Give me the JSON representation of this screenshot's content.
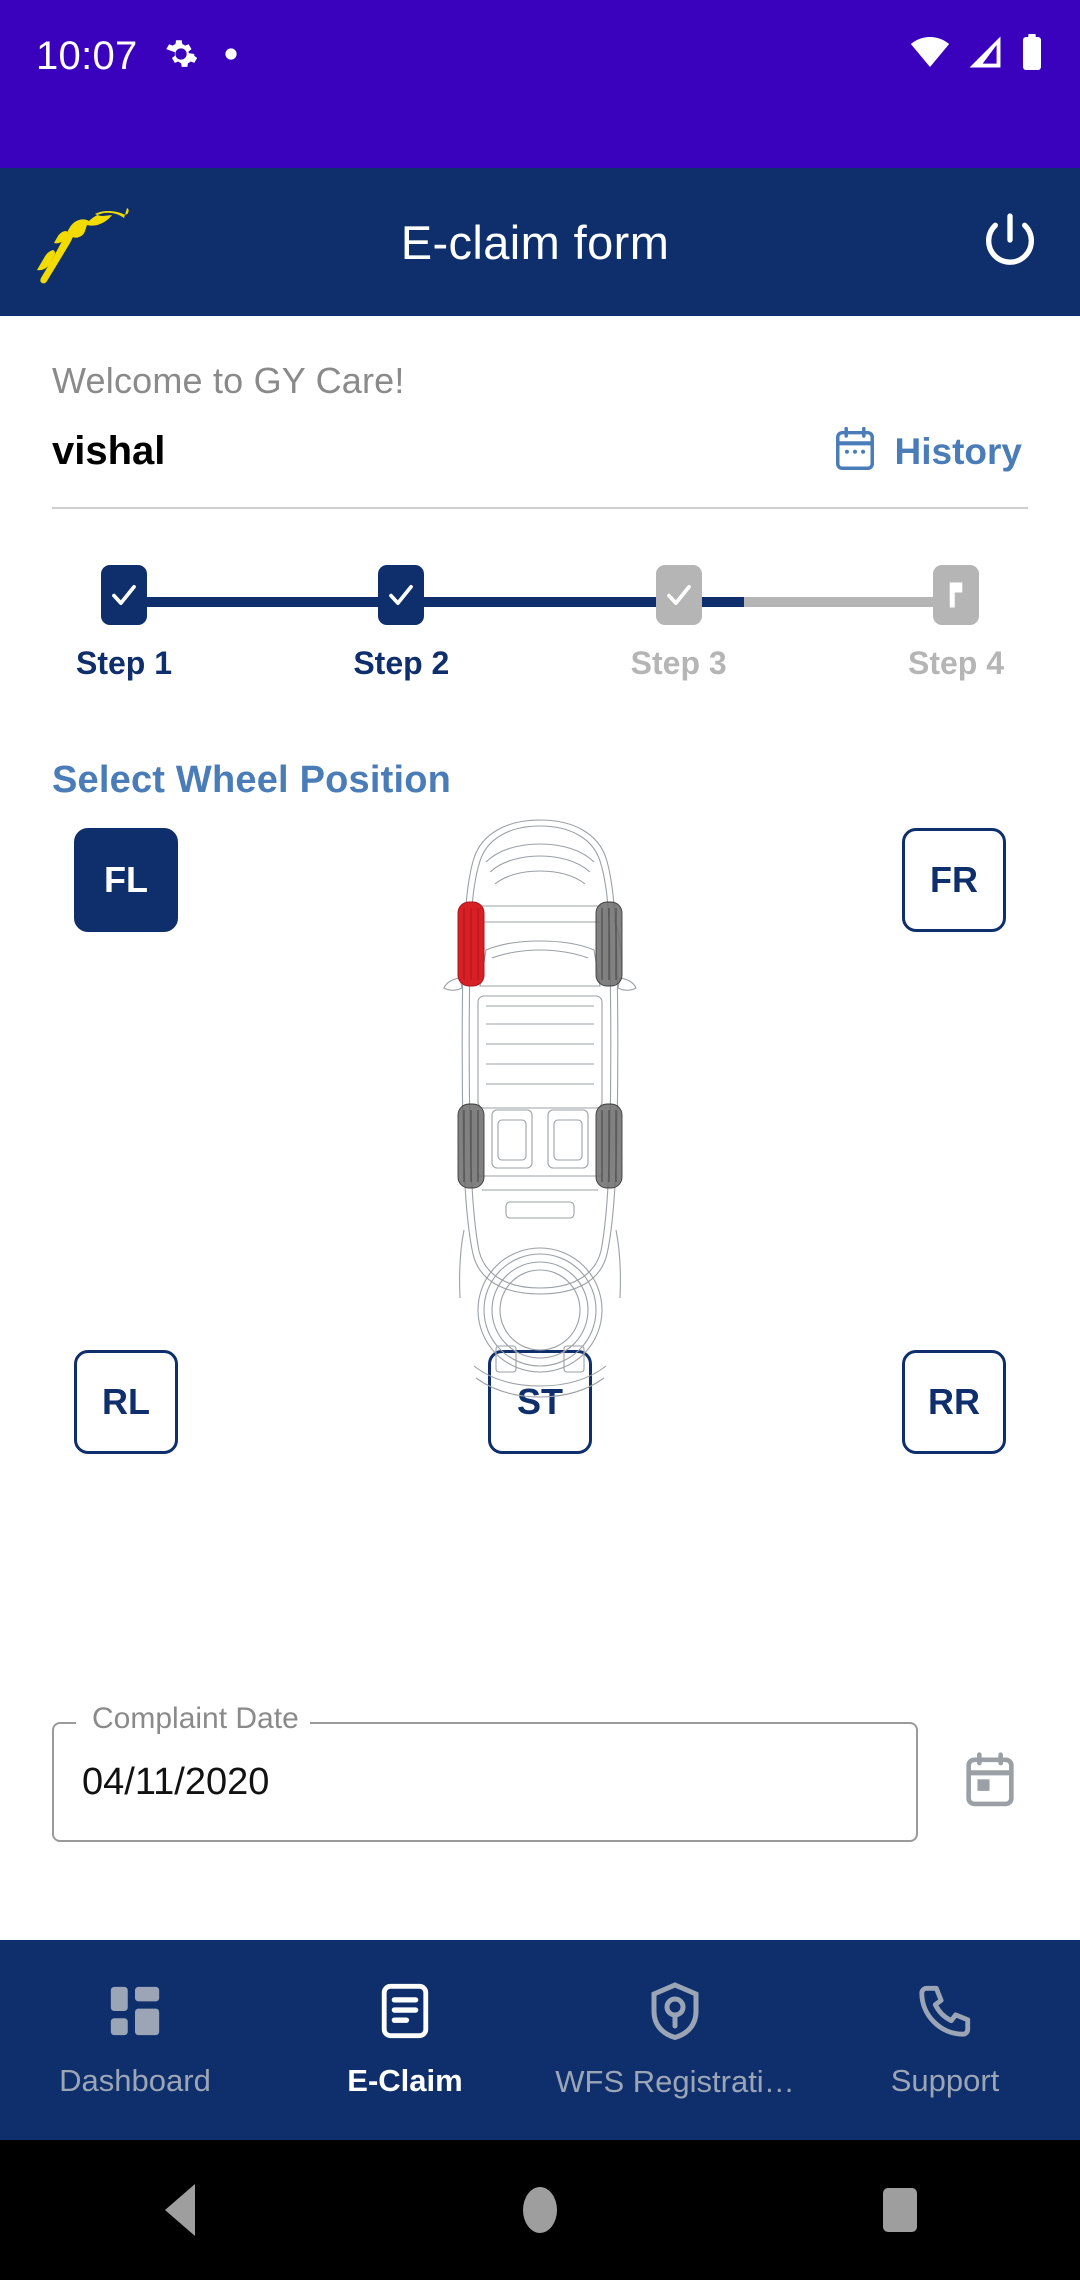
{
  "status_bar": {
    "time": "10:07",
    "icons": [
      "gear-icon",
      "dot-icon",
      "wifi-icon",
      "cellular-icon",
      "battery-icon"
    ],
    "background": "#3A02BC"
  },
  "app_bar": {
    "title": "E-claim form",
    "logo": "goodyear-winged-foot-logo",
    "logout_icon": "power-icon",
    "background": "#0E2F6B",
    "logo_color": "#F2DC00"
  },
  "welcome": {
    "greeting": "Welcome to GY Care!",
    "username": "vishal",
    "history_label": "History",
    "history_icon": "calendar-icon",
    "history_color": "#4A7CB8"
  },
  "stepper": {
    "steps": [
      {
        "label": "Step 1",
        "state": "done",
        "icon": "check-icon"
      },
      {
        "label": "Step 2",
        "state": "done",
        "icon": "check-icon"
      },
      {
        "label": "Step 3",
        "state": "todo",
        "icon": "check-icon"
      },
      {
        "label": "Step 4",
        "state": "todo",
        "icon": "flag-icon"
      }
    ],
    "active_color": "#0E2F6B",
    "inactive_color": "#b5b5b5"
  },
  "wheel_section": {
    "title": "Select Wheel Position",
    "title_color": "#4A7CB8",
    "selected": "FL",
    "highlight_color": "#D81F26",
    "buttons": [
      {
        "code": "FL",
        "name": "front-left",
        "selected": true
      },
      {
        "code": "FR",
        "name": "front-right",
        "selected": false
      },
      {
        "code": "RL",
        "name": "rear-left",
        "selected": false
      },
      {
        "code": "ST",
        "name": "spare-tyre",
        "selected": false
      },
      {
        "code": "RR",
        "name": "rear-right",
        "selected": false
      }
    ],
    "diagram": "car-top-view-wireframe"
  },
  "complaint_date": {
    "label": "Complaint Date",
    "value": "04/11/2020",
    "picker_icon": "calendar-icon"
  },
  "bottom_nav": {
    "items": [
      {
        "label": "Dashboard",
        "icon": "grid-icon",
        "active": false
      },
      {
        "label": "E-Claim",
        "icon": "document-icon",
        "active": true
      },
      {
        "label": "WFS Registrati…",
        "icon": "shield-user-icon",
        "active": false
      },
      {
        "label": "Support",
        "icon": "phone-icon",
        "active": false
      }
    ],
    "background": "#0E2F6B",
    "active_color": "#ffffff",
    "idle_color": "#9ba5b5"
  },
  "android_nav": {
    "back": "back-triangle-icon",
    "home": "home-circle-icon",
    "recents": "recents-square-icon"
  }
}
